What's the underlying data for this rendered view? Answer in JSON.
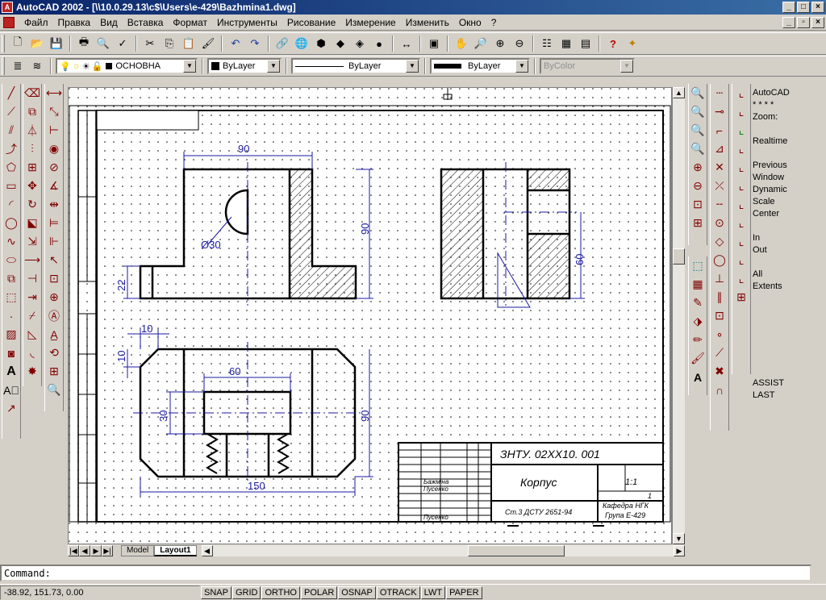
{
  "window": {
    "title": "AutoCAD 2002 - [\\\\10.0.29.13\\c$\\Users\\e-429\\Bazhmina1.dwg]"
  },
  "menu": [
    "Файл",
    "Правка",
    "Вид",
    "Вставка",
    "Формат",
    "Инструменты",
    "Рисование",
    "Измерение",
    "Изменить",
    "Окно",
    "?"
  ],
  "layers": {
    "current": "ОСНОВНА",
    "color": "ByLayer",
    "linetype": "ByLayer",
    "lineweight": "ByLayer",
    "plotstyle": "ByColor"
  },
  "tabs": {
    "model": "Model",
    "layout": "Layout1"
  },
  "drawing": {
    "dims": {
      "d90_top": "90",
      "d90_right": "90",
      "d30_dia": "Ø30",
      "d22": "22",
      "d60_side": "60",
      "d10_a": "10",
      "d10_b": "10",
      "d60_plan": "60",
      "d30_plan": "30",
      "d90_plan": "90",
      "d150": "150"
    },
    "titleblock": {
      "code": "ЗНТУ. 02ХХ10. 001",
      "name": "Корпус",
      "scale": "1:1",
      "sheet": "1",
      "material": "Ст.3 ДСТУ 2651-94",
      "dept": "Кафедра НГК",
      "group": "Група Е-429",
      "author1": "Бажміна",
      "checker": "Пусенко",
      "approver": "Пусенко"
    }
  },
  "info": [
    "AutoCAD",
    "* * * *",
    "Zoom:",
    "",
    "Realtime",
    "",
    "Previous",
    "Window",
    "Dynamic",
    "Scale",
    "Center",
    "",
    "In",
    "Out",
    "",
    "All",
    "Extents",
    "",
    "",
    "",
    "",
    "",
    "",
    "",
    "ASSIST",
    "LAST"
  ],
  "command": {
    "prompt": "Command:"
  },
  "status": {
    "coords": "-38.92, 151.73, 0.00",
    "buttons": [
      "SNAP",
      "GRID",
      "ORTHO",
      "POLAR",
      "OSNAP",
      "OTRACK",
      "LWT",
      "PAPER"
    ]
  }
}
